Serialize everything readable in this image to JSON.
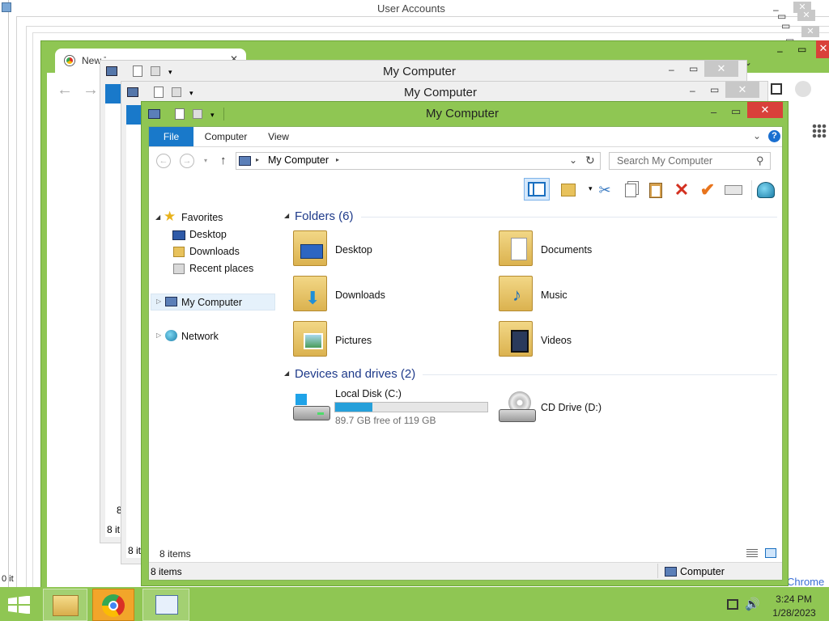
{
  "background_windows": {
    "user_accounts_title": "User Accounts",
    "chrome_tab_title": "New Tab",
    "chrome_footer_text": "Chrome",
    "left_status": "0 it",
    "win1": {
      "title": "My Computer",
      "status": "8 it",
      "items_partial": "8"
    },
    "win2": {
      "title": "My Computer",
      "status": "8 it"
    }
  },
  "window": {
    "title": "My Computer",
    "ribbon_tabs": [
      "File",
      "Computer",
      "View"
    ],
    "address": {
      "location": "My Computer"
    },
    "search_placeholder": "Search My Computer",
    "nav": {
      "favorites": "Favorites",
      "favorites_items": [
        "Desktop",
        "Downloads",
        "Recent places"
      ],
      "computer": "My Computer",
      "network": "Network"
    },
    "folders_header": "Folders (6)",
    "folders": [
      {
        "name": "Desktop",
        "icon": "desktop-folder-icon"
      },
      {
        "name": "Documents",
        "icon": "documents-folder-icon"
      },
      {
        "name": "Downloads",
        "icon": "downloads-folder-icon"
      },
      {
        "name": "Music",
        "icon": "music-folder-icon"
      },
      {
        "name": "Pictures",
        "icon": "pictures-folder-icon"
      },
      {
        "name": "Videos",
        "icon": "videos-folder-icon"
      }
    ],
    "devices_header": "Devices and drives (2)",
    "drives": [
      {
        "name": "Local Disk (C:)",
        "free_text": "89.7 GB free of 119 GB",
        "used_fraction": 0.246
      },
      {
        "name": "CD Drive (D:)"
      }
    ],
    "item_count_inner": "8 items",
    "status_bar": {
      "item_count": "8 items",
      "location_label": "Computer"
    }
  },
  "taskbar": {
    "time": "3:24 PM",
    "date": "1/28/2023"
  },
  "colors": {
    "accent": "#8fc653",
    "file_tab": "#1979ca",
    "close_red": "#d9403a",
    "section_blue": "#1e3a8a"
  }
}
